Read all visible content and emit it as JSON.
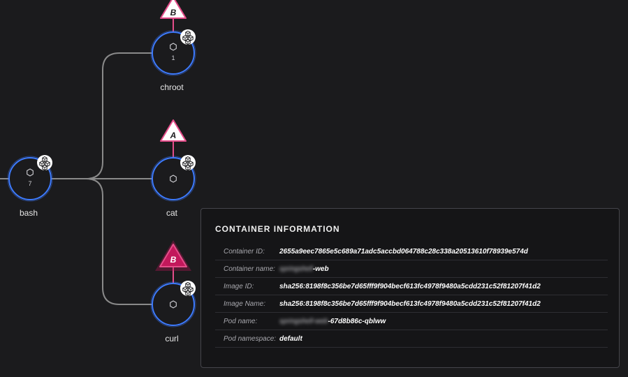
{
  "graph": {
    "nodes": [
      {
        "id": "bash",
        "label": "bash",
        "count": "7"
      },
      {
        "id": "chroot",
        "label": "chroot",
        "count": "1"
      },
      {
        "id": "cat",
        "label": "cat",
        "count": ""
      },
      {
        "id": "curl",
        "label": "curl",
        "count": ""
      }
    ],
    "alerts": [
      {
        "node": "chroot",
        "letter": "B",
        "style": "outline"
      },
      {
        "node": "cat",
        "letter": "A",
        "style": "outline"
      },
      {
        "node": "curl",
        "letter": "B",
        "style": "filled"
      }
    ],
    "colors": {
      "node_ring": "#3d7bff",
      "alert": "#e54d8a",
      "alert_fill": "#c2185b",
      "edge": "#8a8a8a"
    },
    "icons": {
      "node": "hexagon-icon",
      "badge": "container-cubes-icon",
      "alert": "triangle-alert-icon"
    }
  },
  "container_info": {
    "title": "CONTAINER INFORMATION",
    "rows": [
      {
        "key": "Container ID:",
        "value": "2655a9eec7865e5c689a71adc5accbd064788c28c338a20513610f78939e574d"
      },
      {
        "key": "Container name:",
        "value_blurred": "springshell",
        "value": "-web"
      },
      {
        "key": "Image ID:",
        "value": "sha256:8198f8c356be7d65fff9f904becf613fc4978f9480a5cdd231c52f81207f41d2"
      },
      {
        "key": "Image Name:",
        "value": "sha256:8198f8c356be7d65fff9f904becf613fc4978f9480a5cdd231c52f81207f41d2"
      },
      {
        "key": "Pod name:",
        "value_blurred": "springshell-web",
        "value": "-67d8b86c-qblww"
      },
      {
        "key": "Pod namespace:",
        "value": "default"
      }
    ]
  }
}
